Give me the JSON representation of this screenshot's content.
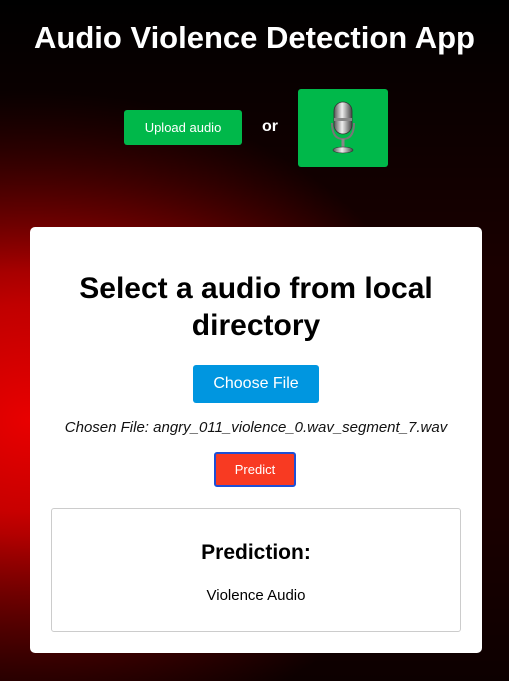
{
  "app": {
    "title": "Audio Violence Detection App"
  },
  "toolbar": {
    "upload_label": "Upload audio",
    "or_label": "or",
    "mic_icon": "microphone-icon"
  },
  "card": {
    "heading": "Select a audio from local directory",
    "choose_label": "Choose File",
    "chosen_file": "Chosen File: angry_011_violence_0.wav_segment_7.wav",
    "predict_label": "Predict"
  },
  "result": {
    "heading": "Prediction:",
    "value": "Violence Audio"
  },
  "colors": {
    "green": "#00b84a",
    "blue": "#0096e0",
    "predict": "#f83a22",
    "background_red": "#e80000"
  }
}
